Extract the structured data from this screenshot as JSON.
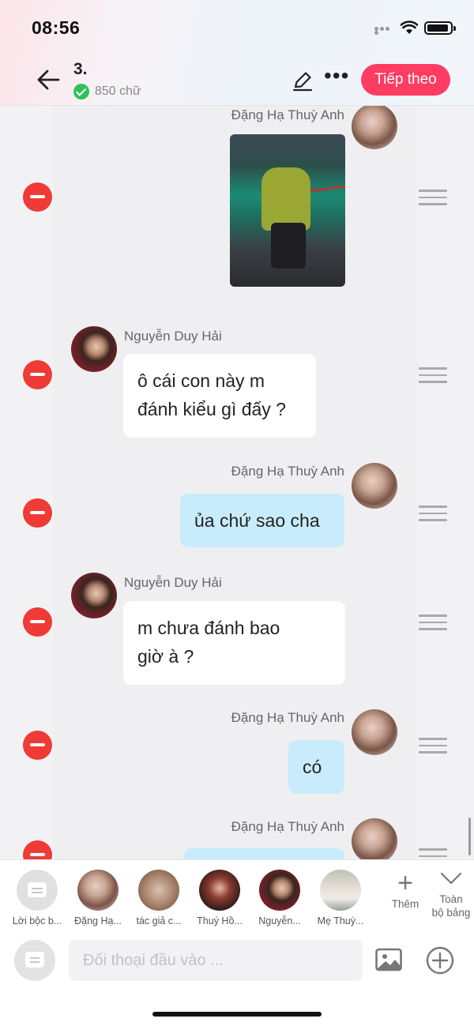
{
  "status_bar": {
    "time": "08:56"
  },
  "header": {
    "chapter_title": "3.",
    "word_count": "850 chữ",
    "next_label": "Tiếp theo"
  },
  "messages": [
    {
      "side": "right",
      "author": "Đặng Hạ Thuỳ Anh",
      "type": "image"
    },
    {
      "side": "left",
      "author": "Nguyễn Duy Hải",
      "lines": [
        "ô cái con này m",
        "đánh kiểu gì đấy ?"
      ]
    },
    {
      "side": "right",
      "author": "Đặng Hạ Thuỳ Anh",
      "lines": [
        "ủa chứ sao cha"
      ]
    },
    {
      "side": "left",
      "author": "Nguyễn Duy Hải",
      "lines": [
        "m chưa đánh bao",
        "giờ à ?"
      ]
    },
    {
      "side": "right",
      "author": "Đặng Hạ Thuỳ Anh",
      "lines": [
        "có"
      ]
    },
    {
      "side": "right",
      "author": "Đặng Hạ Thuỳ Anh",
      "lines": [
        ""
      ]
    }
  ],
  "character_bar": {
    "characters": [
      {
        "label": "Lời bộc b..."
      },
      {
        "label": "Đặng Hạ..."
      },
      {
        "label": "tác giả c..."
      },
      {
        "label": "Thuý Hồ..."
      },
      {
        "label": "Nguyễn..."
      },
      {
        "label": "Mẹ Thuỳ..."
      }
    ],
    "add_label": "Thêm",
    "expand_label_1": "Toàn",
    "expand_label_2": "bộ bảng"
  },
  "input": {
    "placeholder": "Đối thoại đầu vào ..."
  },
  "colors": {
    "accent": "#ff3d62",
    "delete": "#f03a36",
    "bubble_blue": "#c8ecfb",
    "check": "#2fc25b"
  }
}
